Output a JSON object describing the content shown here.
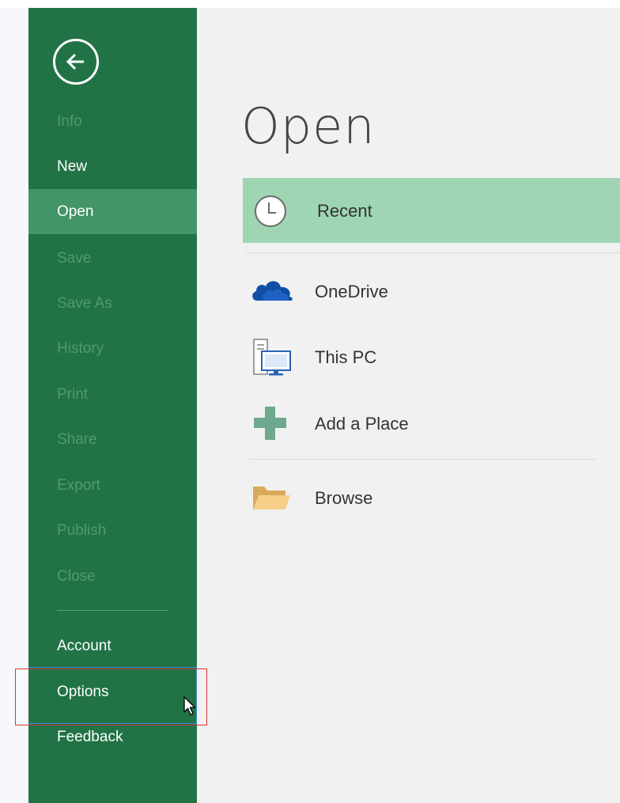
{
  "sidebar": {
    "back_icon": "back-arrow-icon",
    "items": [
      {
        "label": "Info",
        "enabled": false
      },
      {
        "label": "New",
        "enabled": true
      },
      {
        "label": "Open",
        "enabled": true,
        "selected": true
      },
      {
        "label": "Save",
        "enabled": false
      },
      {
        "label": "Save As",
        "enabled": false
      },
      {
        "label": "History",
        "enabled": false
      },
      {
        "label": "Print",
        "enabled": false
      },
      {
        "label": "Share",
        "enabled": false
      },
      {
        "label": "Export",
        "enabled": false
      },
      {
        "label": "Publish",
        "enabled": false
      },
      {
        "label": "Close",
        "enabled": false
      }
    ],
    "bottom_items": [
      {
        "label": "Account"
      },
      {
        "label": "Options"
      },
      {
        "label": "Feedback"
      }
    ]
  },
  "main": {
    "title": "Open",
    "places": [
      {
        "label": "Recent",
        "icon": "clock-icon",
        "selected": true
      },
      {
        "label": "OneDrive",
        "icon": "onedrive-cloud-icon"
      },
      {
        "label": "This PC",
        "icon": "computer-icon"
      },
      {
        "label": "Add a Place",
        "icon": "plus-icon"
      },
      {
        "label": "Browse",
        "icon": "folder-icon"
      }
    ]
  },
  "colors": {
    "sidebar_bg": "#217346",
    "sidebar_selected": "#439467",
    "sidebar_disabled_text": "#4e9a6e",
    "recent_selected_bg": "#9fd5b3",
    "highlight_box": "#d9343c"
  }
}
